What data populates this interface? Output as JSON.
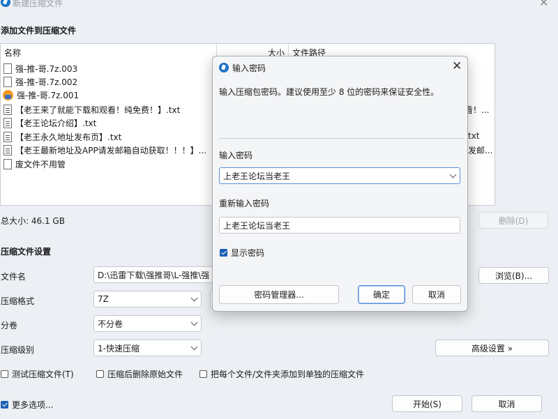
{
  "window": {
    "title": "新建压缩文件"
  },
  "files": {
    "section_title": "添加文件到压缩文件",
    "col_name": "名称",
    "col_size": "大小",
    "col_path": "文件路径",
    "rows": [
      {
        "name": "强-推-哥.7z.003",
        "icon": "file-icon",
        "path": ""
      },
      {
        "name": "强-推-哥.7z.002",
        "icon": "file-icon",
        "path": ""
      },
      {
        "name": "强-推-哥.7z.001",
        "icon": "archive-icon",
        "path": ""
      },
      {
        "name": "【老王来了就能下载和观看！纯免费！】.txt",
        "icon": "text-file-icon",
        "path": "看！..."
      },
      {
        "name": "【老王论坛介绍】.txt",
        "icon": "text-file-icon",
        "path": ""
      },
      {
        "name": "【老王永久地址发布页】.txt",
        "icon": "text-file-icon",
        "path": "txt"
      },
      {
        "name": "【老王最新地址及APP请发邮箱自动获取！！！】...",
        "icon": "text-file-icon",
        "path": "发邮..."
      },
      {
        "name": "废文件不用管",
        "icon": "file-icon",
        "path": ""
      }
    ],
    "total_size": "总大小: 46.1 GB",
    "delete_label": "删除(D)"
  },
  "settings": {
    "section_title": "压缩文件设置",
    "filename_label": "文件名",
    "filename_value": "D:\\迅雷下载\\强推哥\\L-强推\\强",
    "browse_label": "浏览(B)...",
    "format_label": "压缩格式",
    "format_value": "7Z",
    "split_label": "分卷",
    "split_value": "不分卷",
    "level_label": "压缩级别",
    "level_value": "1-快速压缩",
    "advanced_label": "高级设置 »",
    "opt_test": "测试压缩文件(T)",
    "opt_delete": "压缩后删除原始文件",
    "opt_separate": "把每个文件/文件夹添加到单独的压缩文件",
    "more_options": "更多选项...",
    "start_label": "开始(S)",
    "cancel_label": "取消"
  },
  "dialog": {
    "title": "输入密码",
    "hint": "输入压缩包密码。建议使用至少 8 位的密码来保证安全性。",
    "password_label": "输入密码",
    "password_value": "上老王论坛当老王",
    "repeat_label": "重新输入密码",
    "repeat_value": "上老王论坛当老王",
    "show_password": "显示密码",
    "manager_label": "密码管理器...",
    "ok_label": "确定",
    "cancel_label": "取消"
  }
}
